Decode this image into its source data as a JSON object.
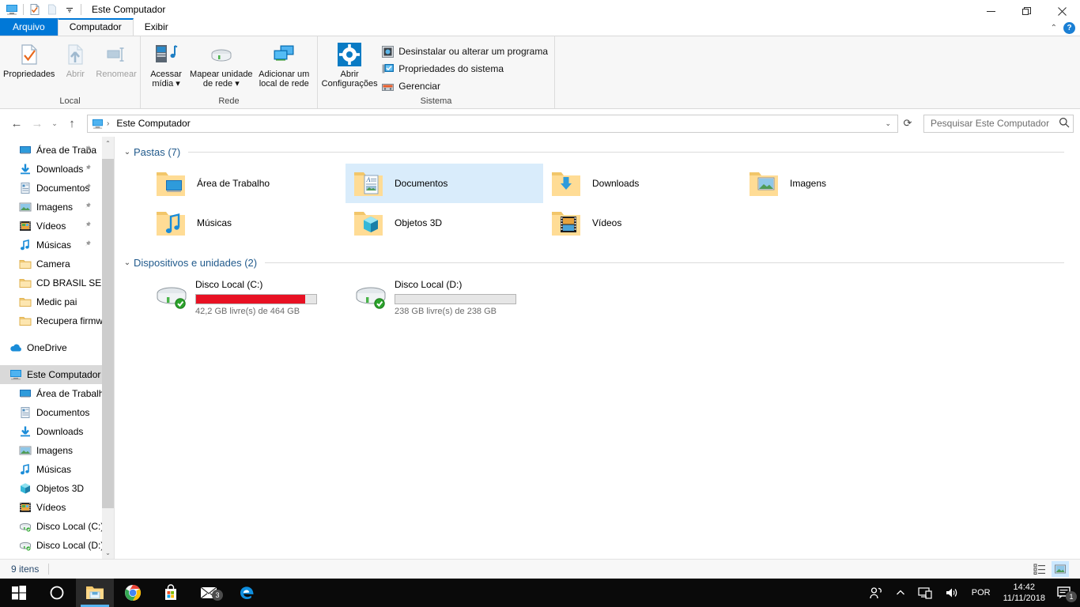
{
  "window": {
    "title": "Este Computador",
    "quick_access": [
      {
        "name": "computer-icon",
        "glyph": "computer"
      },
      {
        "name": "properties-icon",
        "glyph": "doc-check"
      },
      {
        "name": "new-folder-icon",
        "glyph": "blank-doc"
      },
      {
        "name": "customize-qat-icon",
        "glyph": "chevron-down"
      }
    ],
    "controls": {
      "minimize": "—",
      "maximize": "❐",
      "close": "✕"
    },
    "ribbon_collapse": "⌃",
    "help": "?"
  },
  "tabs": [
    {
      "label": "Arquivo",
      "state": "file"
    },
    {
      "label": "Computador",
      "state": "active"
    },
    {
      "label": "Exibir",
      "state": "normal"
    }
  ],
  "ribbon": {
    "groups": [
      {
        "label": "Local",
        "buttons": [
          {
            "label": "Propriedades",
            "icon": "properties-icon",
            "disabled": false
          },
          {
            "label": "Abrir",
            "icon": "open-icon",
            "disabled": true
          },
          {
            "label": "Renomear",
            "icon": "rename-icon",
            "disabled": true
          }
        ]
      },
      {
        "label": "Rede",
        "buttons": [
          {
            "label": "Acessar",
            "label2": "mídia ▾",
            "icon": "media-icon",
            "disabled": false
          },
          {
            "label": "Mapear unidade",
            "label2": "de rede ▾",
            "icon": "map-drive-icon",
            "disabled": false
          },
          {
            "label": "Adicionar um",
            "label2": "local de rede",
            "icon": "add-network-location-icon",
            "disabled": false
          }
        ]
      },
      {
        "label": "Sistema",
        "big": {
          "label": "Abrir",
          "label2": "Configurações",
          "icon": "settings-gear-icon"
        },
        "small": [
          {
            "label": "Desinstalar ou alterar um programa",
            "icon": "uninstall-icon"
          },
          {
            "label": "Propriedades do sistema",
            "icon": "system-properties-icon"
          },
          {
            "label": "Gerenciar",
            "icon": "manage-icon"
          }
        ]
      }
    ]
  },
  "address": {
    "back": "←",
    "forward": "→",
    "recent": "⌄",
    "up": "↑",
    "crumb_icon": "computer-icon",
    "crumb": "Este Computador",
    "separator": "›",
    "dropdown": "⌄",
    "refresh": "⟳"
  },
  "search": {
    "placeholder": "Pesquisar Este Computador",
    "value": "",
    "icon": "search-icon"
  },
  "sidebar": {
    "scroll_up": "⌃",
    "scroll_down": "⌄",
    "items": [
      {
        "label": "Área de Traba",
        "icon": "desktop-icon",
        "level": 1,
        "pinned": true
      },
      {
        "label": "Downloads",
        "icon": "downloads-icon",
        "level": 1,
        "pinned": true
      },
      {
        "label": "Documentos",
        "icon": "documents-icon",
        "level": 1,
        "pinned": true
      },
      {
        "label": "Imagens",
        "icon": "pictures-icon",
        "level": 1,
        "pinned": true
      },
      {
        "label": "Vídeos",
        "icon": "videos-icon",
        "level": 1,
        "pinned": true
      },
      {
        "label": "Músicas",
        "icon": "music-icon",
        "level": 1,
        "pinned": true
      },
      {
        "label": "Camera",
        "icon": "folder-icon",
        "level": 1,
        "pinned": false
      },
      {
        "label": "CD BRASIL SERTA",
        "icon": "folder-icon",
        "level": 1,
        "pinned": false
      },
      {
        "label": "Medic pai",
        "icon": "folder-icon",
        "level": 1,
        "pinned": false
      },
      {
        "label": "Recupera firmwa",
        "icon": "folder-icon",
        "level": 1,
        "pinned": false
      },
      {
        "label": "OneDrive",
        "icon": "onedrive-icon",
        "level": 0,
        "pinned": false,
        "spaced": true
      },
      {
        "label": "Este Computador",
        "icon": "computer-icon",
        "level": 0,
        "pinned": false,
        "selected": true,
        "spaced": true
      },
      {
        "label": "Área de Trabalho",
        "icon": "desktop-icon",
        "level": 1,
        "pinned": false
      },
      {
        "label": "Documentos",
        "icon": "documents-icon",
        "level": 1,
        "pinned": false
      },
      {
        "label": "Downloads",
        "icon": "downloads-icon",
        "level": 1,
        "pinned": false
      },
      {
        "label": "Imagens",
        "icon": "pictures-icon",
        "level": 1,
        "pinned": false
      },
      {
        "label": "Músicas",
        "icon": "music-icon",
        "level": 1,
        "pinned": false
      },
      {
        "label": "Objetos 3D",
        "icon": "objects3d-icon",
        "level": 1,
        "pinned": false
      },
      {
        "label": "Vídeos",
        "icon": "videos-icon",
        "level": 1,
        "pinned": false
      },
      {
        "label": "Disco Local (C:)",
        "icon": "drive-icon",
        "level": 1,
        "pinned": false
      },
      {
        "label": "Disco Local (D:)",
        "icon": "drive-icon",
        "level": 1,
        "pinned": false
      }
    ]
  },
  "content": {
    "folders_group": {
      "chevron": "⌄",
      "title": "Pastas (7)",
      "items": [
        {
          "label": "Área de Trabalho",
          "icon": "folder-desktop-icon",
          "selected": false
        },
        {
          "label": "Documentos",
          "icon": "folder-documents-icon",
          "selected": true
        },
        {
          "label": "Downloads",
          "icon": "folder-downloads-icon",
          "selected": false
        },
        {
          "label": "Imagens",
          "icon": "folder-pictures-icon",
          "selected": false
        },
        {
          "label": "Músicas",
          "icon": "folder-music-icon",
          "selected": false
        },
        {
          "label": "Objetos 3D",
          "icon": "folder-objects3d-icon",
          "selected": false
        },
        {
          "label": "Vídeos",
          "icon": "folder-videos-icon",
          "selected": false
        }
      ]
    },
    "devices_group": {
      "chevron": "⌄",
      "title": "Dispositivos e unidades (2)",
      "items": [
        {
          "label": "Disco Local (C:)",
          "icon": "hard-drive-icon",
          "free_text": "42,2 GB livre(s) de 464 GB",
          "free_gb": 42.2,
          "total_gb": 464,
          "used_percent": 91,
          "bar_color": "#e81123",
          "low_space": true
        },
        {
          "label": "Disco Local (D:)",
          "icon": "hard-drive-icon",
          "free_text": "238 GB livre(s) de 238 GB",
          "free_gb": 238,
          "total_gb": 238,
          "used_percent": 0,
          "bar_color": "#26a0da",
          "low_space": false
        }
      ]
    }
  },
  "status": {
    "item_count": "9 itens",
    "views": [
      {
        "name": "details-view-button",
        "active": false
      },
      {
        "name": "large-icons-view-button",
        "active": true
      }
    ]
  },
  "taskbar": {
    "items": [
      {
        "name": "start-button",
        "icon": "windows-logo-icon",
        "active": false
      },
      {
        "name": "cortana-button",
        "icon": "cortana-circle-icon",
        "active": false
      },
      {
        "name": "file-explorer-button",
        "icon": "file-explorer-icon",
        "active": true
      },
      {
        "name": "chrome-button",
        "icon": "chrome-icon",
        "active": false,
        "running": true
      },
      {
        "name": "store-button",
        "icon": "microsoft-store-icon",
        "active": false
      },
      {
        "name": "mail-button",
        "icon": "mail-icon",
        "active": false,
        "badge": "3"
      },
      {
        "name": "edge-button",
        "icon": "edge-icon",
        "active": false
      }
    ],
    "tray": {
      "people": "people-icon",
      "show_hidden": "⌃",
      "network": "network-icon",
      "volume": "volume-icon",
      "language": "POR",
      "time": "14:42",
      "date": "11/11/2018",
      "notifications_badge": "1"
    }
  },
  "colors": {
    "accent": "#0078d7",
    "selection": "#d9ecfb",
    "group_title": "#215a8c",
    "drive_low": "#e81123",
    "taskbar": "#0a0a0a"
  }
}
